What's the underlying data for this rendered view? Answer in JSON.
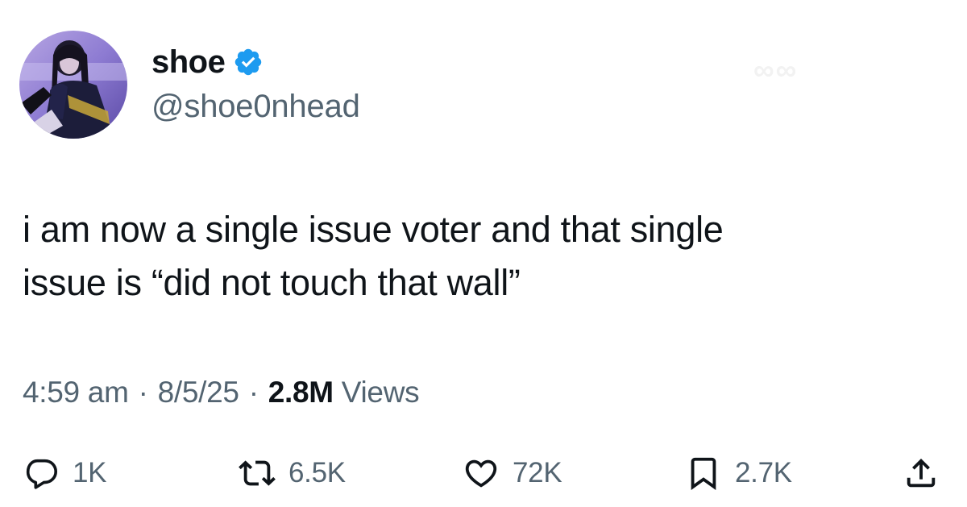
{
  "author": {
    "display_name": "shoe",
    "handle": "@shoe0nhead",
    "verified_icon": "verified-badge-icon",
    "badge_color": "#1d9bf0"
  },
  "tweet": {
    "text_line1": "i am now a single issue voter and that single",
    "text_line2": "issue is “did not touch that wall”"
  },
  "meta": {
    "time": "4:59 am",
    "separator": "·",
    "date": "8/5/25",
    "views_count": "2.8M",
    "views_label": "Views"
  },
  "actions": {
    "reply": {
      "icon": "reply-icon",
      "count": "1K"
    },
    "retweet": {
      "icon": "retweet-icon",
      "count": "6.5K"
    },
    "like": {
      "icon": "heart-icon",
      "count": "72K"
    },
    "bookmark": {
      "icon": "bookmark-icon",
      "count": "2.7K"
    },
    "share": {
      "icon": "share-icon"
    }
  },
  "colors": {
    "text_primary": "#0f1419",
    "text_secondary": "#536471",
    "accent": "#1d9bf0"
  }
}
